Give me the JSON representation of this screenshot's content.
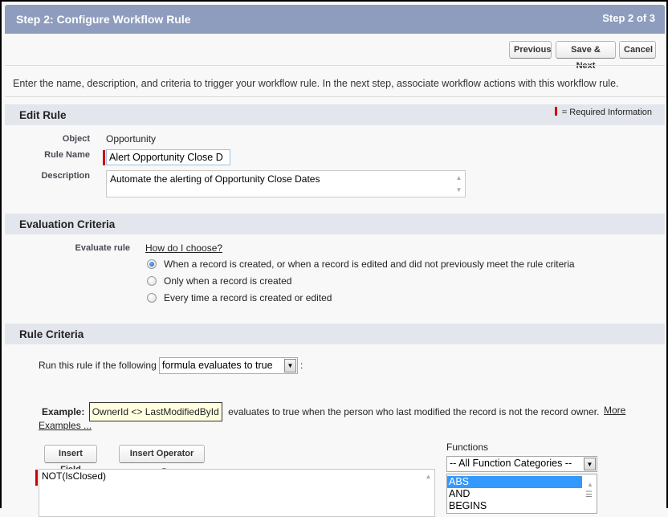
{
  "header": {
    "title": "Step 2: Configure Workflow Rule",
    "step": "Step 2 of 3"
  },
  "toolbar": {
    "previous_label": "Previous",
    "save_next_label": "Save & Next",
    "cancel_label": "Cancel"
  },
  "intro": "Enter the name, description, and criteria to trigger your workflow rule. In the next step, associate workflow actions with this workflow rule.",
  "edit_rule": {
    "heading": "Edit Rule",
    "required_legend": "= Required Information",
    "object_label": "Object",
    "object_value": "Opportunity",
    "rule_name_label": "Rule Name",
    "rule_name_value": "Alert Opportunity Close D",
    "description_label": "Description",
    "description_value": "Automate the alerting of Opportunity Close Dates"
  },
  "evaluation": {
    "heading": "Evaluation Criteria",
    "evaluate_label": "Evaluate rule",
    "help_link": "How do I choose?",
    "options": [
      {
        "label": "When a record is created, or when a record is edited and did not previously meet the rule criteria",
        "selected": true
      },
      {
        "label": "Only when a record is created",
        "selected": false
      },
      {
        "label": "Every time a record is created or edited",
        "selected": false
      }
    ]
  },
  "rule_criteria": {
    "heading": "Rule Criteria",
    "run_prefix": "Run this rule if the following",
    "run_select_value": "formula evaluates to true",
    "run_suffix": ":",
    "example_label": "Example:",
    "example_formula": "OwnerId <> LastModifiedById",
    "example_text": "evaluates to true when the person who last modified the record is not the record owner.",
    "more_examples_link_1": "More",
    "more_examples_link_2": "Examples ...",
    "insert_field_label": "Insert Field",
    "insert_operator_label": "Insert Operator",
    "formula_value": "NOT(IsClosed)",
    "functions_label": "Functions",
    "function_category_value": "-- All Function Categories --",
    "functions": [
      {
        "name": "ABS",
        "selected": true
      },
      {
        "name": "AND",
        "selected": false
      },
      {
        "name": "BEGINS",
        "selected": false
      }
    ]
  }
}
